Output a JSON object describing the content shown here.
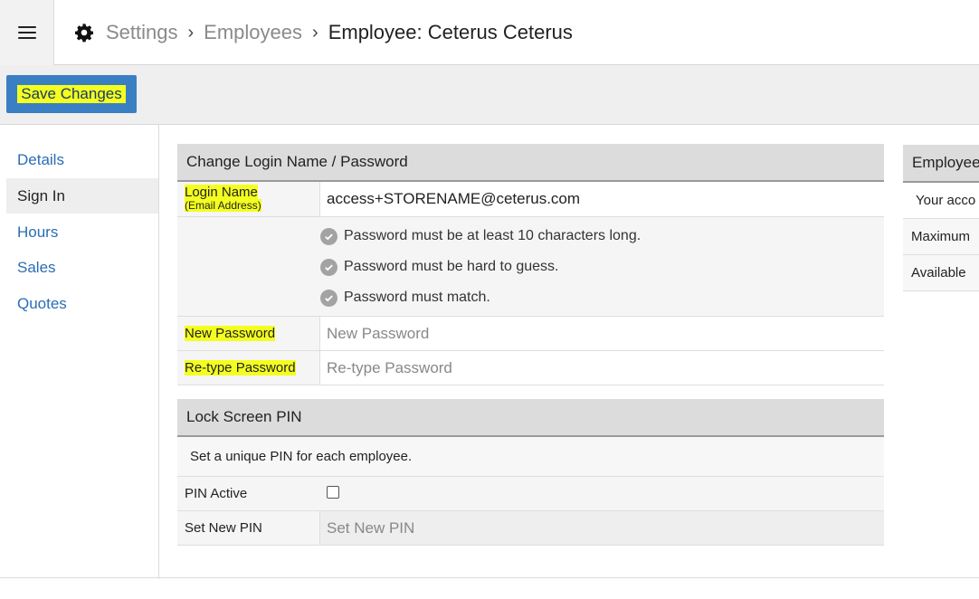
{
  "breadcrumb": {
    "items": [
      "Settings",
      "Employees"
    ],
    "current": "Employee:  Ceterus Ceterus"
  },
  "toolbar": {
    "save_label": "Save Changes"
  },
  "sidebar": {
    "items": [
      {
        "label": "Details"
      },
      {
        "label": "Sign In",
        "active": true
      },
      {
        "label": "Hours"
      },
      {
        "label": "Sales"
      },
      {
        "label": "Quotes"
      }
    ]
  },
  "login_panel": {
    "title": "Change Login Name / Password",
    "login_label": "Login Name",
    "login_sub": "(Email Address)",
    "login_value": "access+STORENAME@ceterus.com",
    "rules": [
      "Password must be at least 10 characters long.",
      "Password must be hard to guess.",
      "Password must match."
    ],
    "new_password_label": "New Password",
    "new_password_placeholder": "New Password",
    "retype_label": "Re-type Password",
    "retype_placeholder": "Re-type Password"
  },
  "pin_panel": {
    "title": "Lock Screen PIN",
    "note": "Set a unique PIN for each employee.",
    "active_label": "PIN Active",
    "active_checked": false,
    "new_pin_label": "Set New PIN",
    "new_pin_placeholder": "Set New PIN"
  },
  "right_panel": {
    "title": "Employee",
    "rows": [
      "Your acco",
      "Maximum",
      "Available"
    ]
  },
  "colors": {
    "accent": "#3a7fc4",
    "highlight": "#f4ff1f",
    "link": "#2a6db3"
  },
  "icons": {
    "menu": "hamburger-icon",
    "settings": "gear-icon",
    "separator": "chevron-right-icon",
    "rule": "check-circle-icon"
  }
}
